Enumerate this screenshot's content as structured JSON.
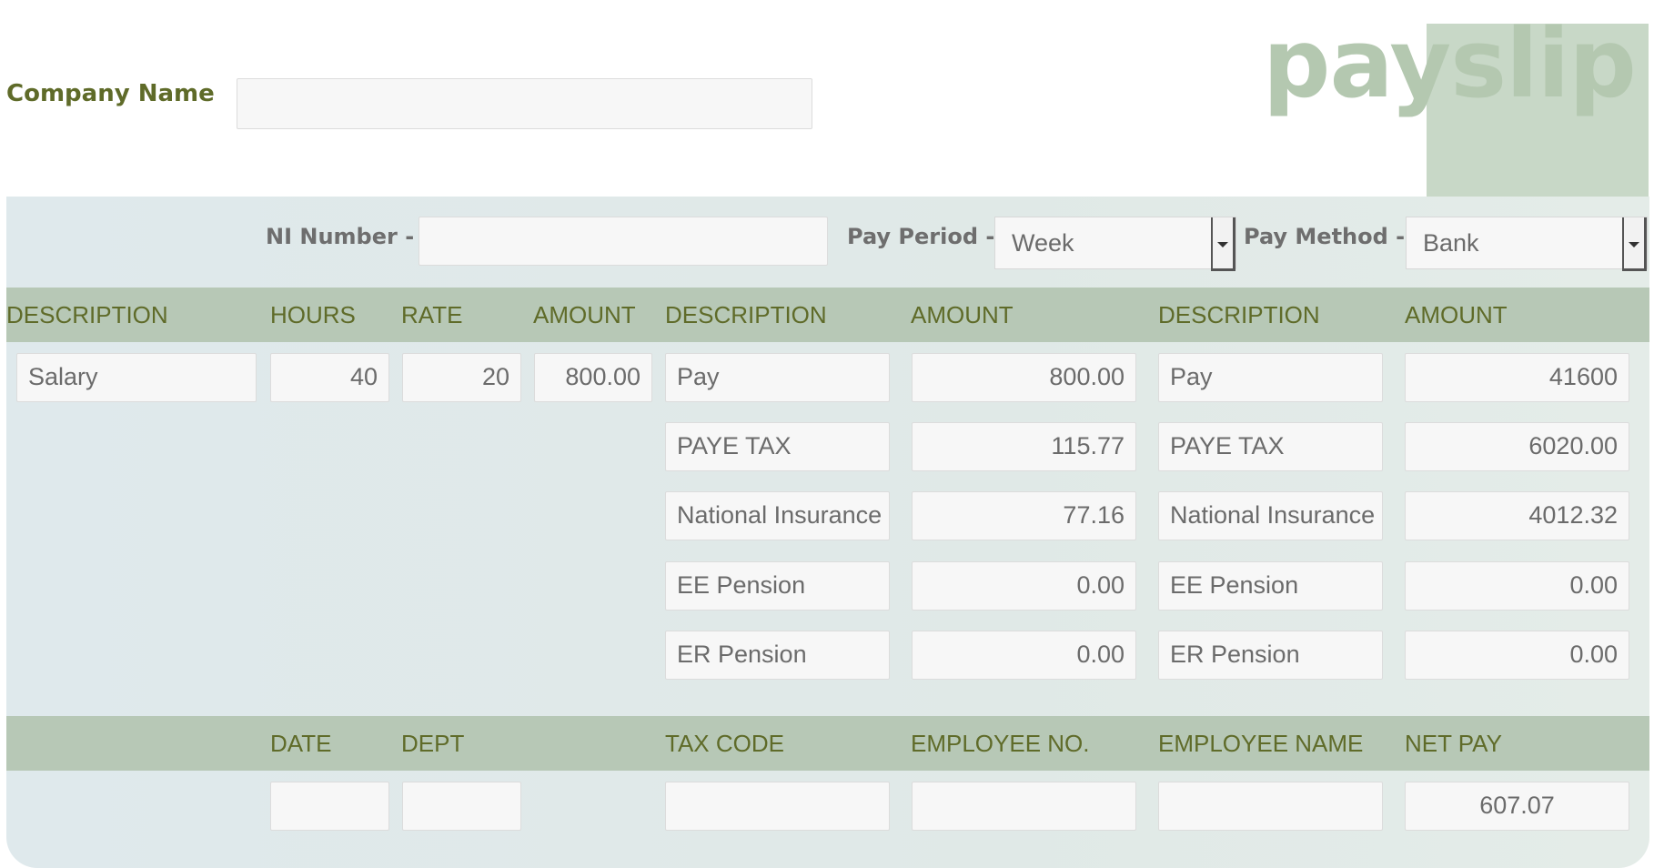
{
  "header": {
    "company_label": "Company Name",
    "company_value": "",
    "logo_text": "payslip"
  },
  "controls": {
    "ni_label": "NI Number -",
    "ni_value": "",
    "pay_period_label": "Pay Period -",
    "pay_period_value": "Week",
    "pay_method_label": "Pay Method -",
    "pay_method_value": "Bank"
  },
  "columns": {
    "description1": "DESCRIPTION",
    "hours": "HOURS",
    "rate": "RATE",
    "amount1": "AMOUNT",
    "description2": "DESCRIPTION",
    "amount2": "AMOUNT",
    "description3": "DESCRIPTION",
    "amount3": "AMOUNT"
  },
  "earnings": {
    "description": "Salary",
    "hours": "40",
    "rate": "20",
    "amount": "800.00"
  },
  "period_items": [
    {
      "label": "Pay",
      "amount": "800.00"
    },
    {
      "label": "PAYE TAX",
      "amount": "115.77"
    },
    {
      "label": "National Insurance",
      "amount": "77.16"
    },
    {
      "label": "EE Pension",
      "amount": "0.00"
    },
    {
      "label": "ER Pension",
      "amount": "0.00"
    }
  ],
  "ytd_items": [
    {
      "label": "Pay",
      "amount": "41600"
    },
    {
      "label": "PAYE TAX",
      "amount": "6020.00"
    },
    {
      "label": "National Insurance",
      "amount": "4012.32"
    },
    {
      "label": "EE Pension",
      "amount": "0.00"
    },
    {
      "label": "ER Pension",
      "amount": "0.00"
    }
  ],
  "footer": {
    "date_label": "DATE",
    "dept_label": "DEPT",
    "tax_code_label": "TAX CODE",
    "employee_no_label": "EMPLOYEE NO.",
    "employee_name_label": "EMPLOYEE NAME",
    "net_pay_label": "NET PAY",
    "date_value": "",
    "dept_value": "",
    "tax_code_value": "",
    "employee_no_value": "",
    "employee_name_value": "",
    "net_pay_value": "607.07"
  },
  "colors": {
    "accent_text": "#5f6b29",
    "band": "#b7c8b6",
    "panel": "#e0e9e7",
    "logo": "#b4c8b0"
  }
}
